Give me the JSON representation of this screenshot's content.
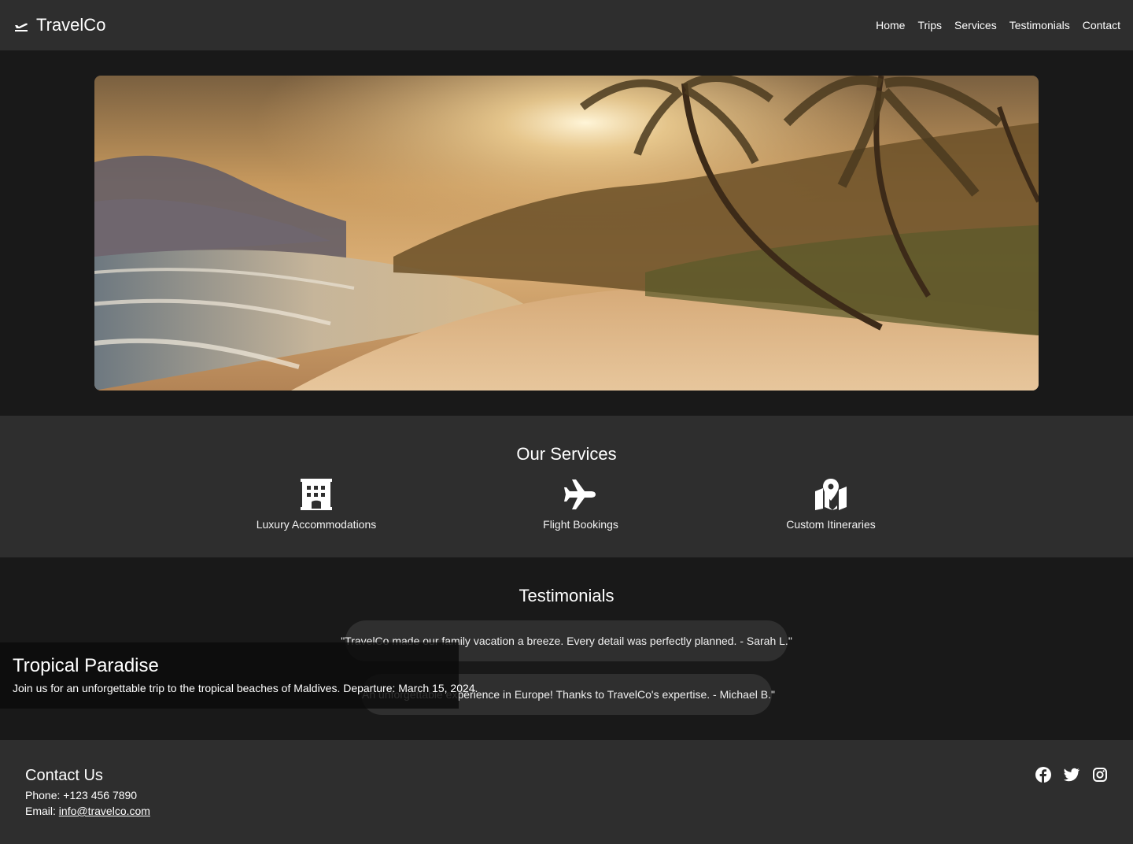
{
  "header": {
    "brand": "TravelCo",
    "brand_icon": "plane-departure-icon",
    "nav": [
      "Home",
      "Trips",
      "Services",
      "Testimonials",
      "Contact"
    ]
  },
  "hero": {
    "image": "tropical-beach-sunset-image"
  },
  "services": {
    "title": "Our Services",
    "items": [
      {
        "icon": "hotel-icon",
        "label": "Luxury Accommodations"
      },
      {
        "icon": "plane-icon",
        "label": "Flight Bookings"
      },
      {
        "icon": "map-location-icon",
        "label": "Custom Itineraries"
      }
    ]
  },
  "testimonials": {
    "title": "Testimonials",
    "items": [
      "\"TravelCo made our family vacation a breeze. Every detail was perfectly planned. - Sarah L.\"",
      "\"An unforgettable experience in Europe! Thanks to TravelCo's expertise. - Michael B.\""
    ]
  },
  "trip": {
    "title": "Tropical Paradise",
    "description": "Join us for an unforgettable trip to the tropical beaches of Maldives. Departure: March 15, 2024."
  },
  "footer": {
    "title": "Contact Us",
    "phone_label": "Phone: ",
    "phone": "+123 456 7890",
    "email_label": "Email: ",
    "email": "info@travelco.com",
    "social": [
      "facebook-icon",
      "twitter-icon",
      "instagram-icon"
    ]
  },
  "colors": {
    "header_bg": "#2e2e2e",
    "page_bg": "#191919",
    "bubble_bg": "#2f2f2f",
    "text": "#ffffff"
  }
}
